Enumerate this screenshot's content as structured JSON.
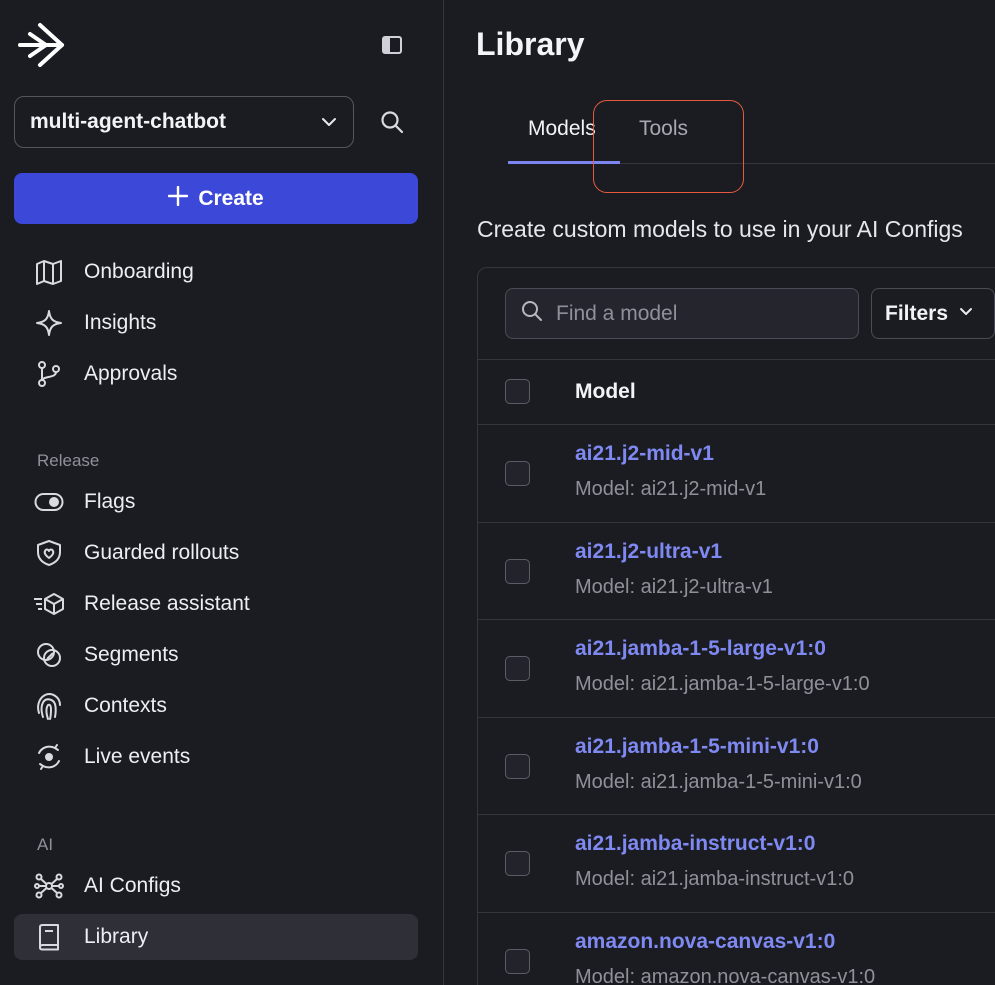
{
  "sidebar": {
    "project_name": "multi-agent-chatbot",
    "create_label": "Create",
    "top_items": [
      {
        "label": "Onboarding",
        "icon": "map-icon"
      },
      {
        "label": "Insights",
        "icon": "sparkle-icon"
      },
      {
        "label": "Approvals",
        "icon": "git-branch-icon"
      }
    ],
    "release_section": {
      "title": "Release",
      "items": [
        {
          "label": "Flags",
          "icon": "toggle-icon"
        },
        {
          "label": "Guarded rollouts",
          "icon": "shield-icon"
        },
        {
          "label": "Release assistant",
          "icon": "release-assistant-icon"
        },
        {
          "label": "Segments",
          "icon": "segments-icon"
        },
        {
          "label": "Contexts",
          "icon": "fingerprint-icon"
        },
        {
          "label": "Live events",
          "icon": "live-events-icon"
        }
      ]
    },
    "ai_section": {
      "title": "AI",
      "items": [
        {
          "label": "AI Configs",
          "icon": "ai-configs-icon"
        },
        {
          "label": "Library",
          "icon": "book-icon",
          "active": true
        }
      ]
    }
  },
  "main": {
    "title": "Library",
    "tabs": [
      {
        "label": "Models",
        "active": true
      },
      {
        "label": "Tools",
        "active": false
      }
    ],
    "description": "Create custom models to use in your AI Configs",
    "search": {
      "placeholder": "Find a model",
      "value": ""
    },
    "filters_label": "Filters",
    "table": {
      "column_header": "Model",
      "rows": [
        {
          "name": "ai21.j2-mid-v1",
          "sub": "Model: ai21.j2-mid-v1"
        },
        {
          "name": "ai21.j2-ultra-v1",
          "sub": "Model: ai21.j2-ultra-v1"
        },
        {
          "name": "ai21.jamba-1-5-large-v1:0",
          "sub": "Model: ai21.jamba-1-5-large-v1:0"
        },
        {
          "name": "ai21.jamba-1-5-mini-v1:0",
          "sub": "Model: ai21.jamba-1-5-mini-v1:0"
        },
        {
          "name": "ai21.jamba-instruct-v1:0",
          "sub": "Model: ai21.jamba-instruct-v1:0"
        },
        {
          "name": "amazon.nova-canvas-v1:0",
          "sub": "Model: amazon.nova-canvas-v1:0"
        }
      ]
    }
  },
  "colors": {
    "background": "#1b1c22",
    "accent": "#3b48d8",
    "link": "#7f89f2",
    "highlight": "#e65a41"
  }
}
